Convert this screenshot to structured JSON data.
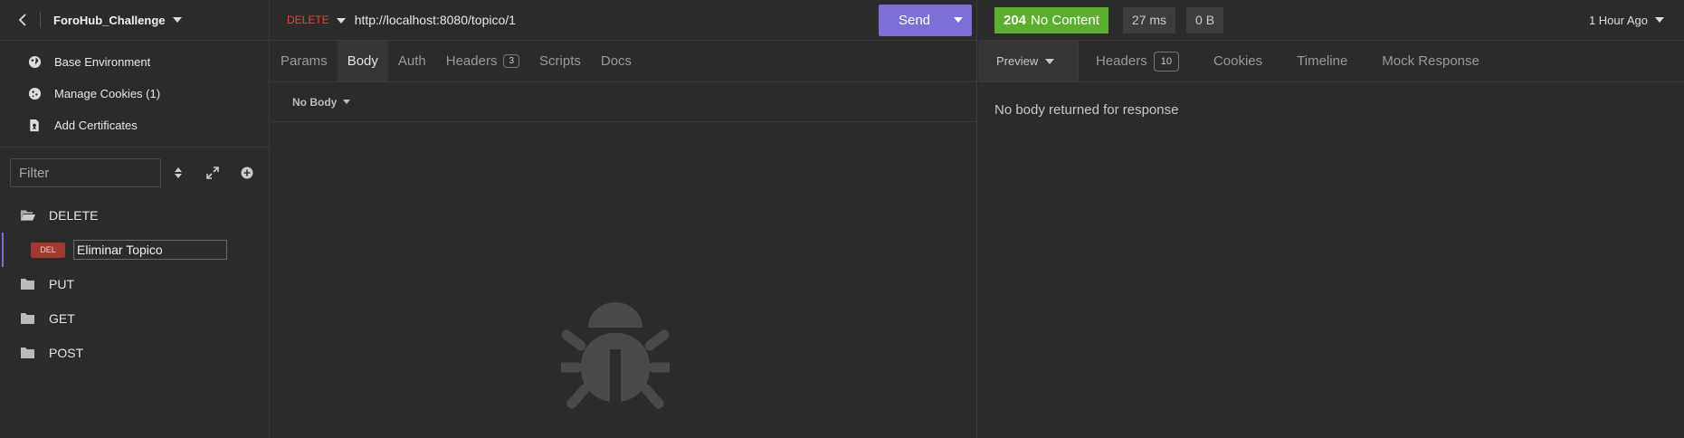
{
  "sidebar": {
    "project_title": "ForoHub_Challenge",
    "menu": [
      {
        "label": "Base Environment",
        "icon": "globe-icon"
      },
      {
        "label": "Manage Cookies (1)",
        "icon": "cookie-icon"
      },
      {
        "label": "Add Certificates",
        "icon": "certificate-icon"
      }
    ],
    "filter_placeholder": "Filter",
    "tree": {
      "folder_delete": "DELETE",
      "request_method_badge": "DEL",
      "request_name": "Eliminar Topico",
      "folder_put": "PUT",
      "folder_get": "GET",
      "folder_post": "POST"
    }
  },
  "request": {
    "method": "DELETE",
    "url": "http://localhost:8080/topico/1",
    "send_label": "Send",
    "tabs": {
      "params": "Params",
      "body": "Body",
      "auth": "Auth",
      "headers": "Headers",
      "headers_count": "3",
      "scripts": "Scripts",
      "docs": "Docs"
    },
    "body_type": "No Body"
  },
  "response": {
    "status_code": "204",
    "status_text": "No Content",
    "time": "27 ms",
    "size": "0 B",
    "time_ago": "1 Hour Ago",
    "tabs": {
      "preview": "Preview",
      "headers": "Headers",
      "headers_count": "10",
      "cookies": "Cookies",
      "timeline": "Timeline",
      "mock": "Mock Response"
    },
    "body_message": "No body returned for response"
  },
  "colors": {
    "accent": "#7d6fd8",
    "status_ok": "#5cae2e",
    "delete": "#e04a3d"
  }
}
